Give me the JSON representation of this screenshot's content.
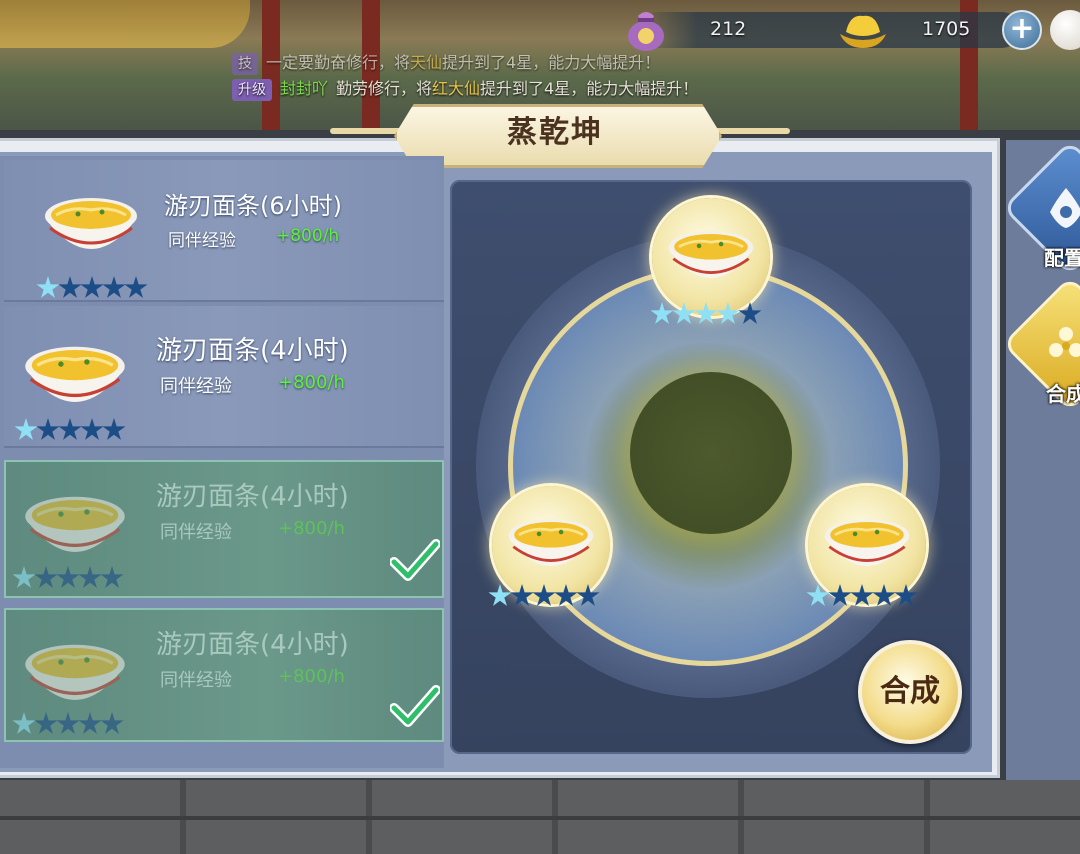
{
  "currency": {
    "pouch_value": "212",
    "gold_value": "1705"
  },
  "chat": {
    "line1": {
      "tag": "技",
      "text": "一定要勤奋修行，将",
      "highlight": "天仙",
      "rest": "提升到了4星，能力大幅提升！"
    },
    "line2": {
      "tag": "升级",
      "name": "封封吖",
      "text": "勤劳修行，将",
      "highlight": "红大仙",
      "rest": "提升到了4星，能力大幅提升！"
    }
  },
  "window": {
    "title": "蒸乾坤"
  },
  "recipes": [
    {
      "name": "游刃面条(6小时)",
      "desc_label": "同伴经验",
      "desc_value": "+800/h",
      "stars": 1,
      "selected": false
    },
    {
      "name": "游刃面条(4小时)",
      "desc_label": "同伴经验",
      "desc_value": "+800/h",
      "stars": 1,
      "selected": false
    },
    {
      "name": "游刃面条(4小时)",
      "desc_label": "同伴经验",
      "desc_value": "+800/h",
      "stars": 1,
      "selected": true
    },
    {
      "name": "游刃面条(4小时)",
      "desc_label": "同伴经验",
      "desc_value": "+800/h",
      "stars": 1,
      "selected": true
    }
  ],
  "slots": {
    "top_stars": 4,
    "left_stars": 1,
    "right_stars": 1
  },
  "combine_label": "合成",
  "side_tabs": {
    "tab1_label": "配置",
    "tab2_label": "合成"
  },
  "colors": {
    "exp_green": "#5ef03a",
    "star_lit": "#8fe0f5",
    "star_dim": "#1d4d86",
    "gold_tab": "#e9c63a",
    "blue_tab": "#3f6da8"
  }
}
